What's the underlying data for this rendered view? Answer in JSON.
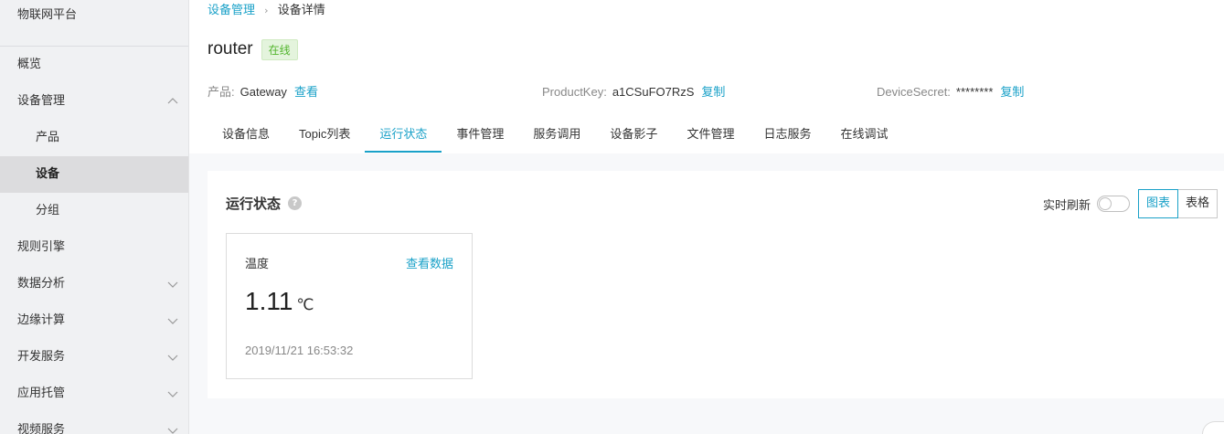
{
  "sidebar": {
    "title": "物联网平台",
    "items": [
      {
        "label": "概览",
        "type": "top",
        "chevron": "none"
      },
      {
        "label": "设备管理",
        "type": "top",
        "chevron": "up"
      },
      {
        "label": "产品",
        "type": "sub",
        "chevron": "none"
      },
      {
        "label": "设备",
        "type": "sub",
        "chevron": "none",
        "active": true
      },
      {
        "label": "分组",
        "type": "sub",
        "chevron": "none"
      },
      {
        "label": "规则引擎",
        "type": "top",
        "chevron": "none"
      },
      {
        "label": "数据分析",
        "type": "top",
        "chevron": "down"
      },
      {
        "label": "边缘计算",
        "type": "top",
        "chevron": "down"
      },
      {
        "label": "开发服务",
        "type": "top",
        "chevron": "down"
      },
      {
        "label": "应用托管",
        "type": "top",
        "chevron": "down"
      },
      {
        "label": "视频服务",
        "type": "top",
        "chevron": "down"
      }
    ]
  },
  "breadcrumb": {
    "parent": "设备管理",
    "separator": "›",
    "current": "设备详情"
  },
  "device": {
    "name": "router",
    "status": "在线"
  },
  "meta": {
    "product_key_label": "产品:",
    "product_value": "Gateway",
    "product_action": "查看",
    "productkey_label": "ProductKey:",
    "productkey_value": "a1CSuFO7RzS",
    "productkey_action": "复制",
    "devicesecret_label": "DeviceSecret:",
    "devicesecret_value": "********",
    "devicesecret_action": "复制"
  },
  "tabs": [
    {
      "label": "设备信息",
      "active": false
    },
    {
      "label": "Topic列表",
      "active": false
    },
    {
      "label": "运行状态",
      "active": true
    },
    {
      "label": "事件管理",
      "active": false
    },
    {
      "label": "服务调用",
      "active": false
    },
    {
      "label": "设备影子",
      "active": false
    },
    {
      "label": "文件管理",
      "active": false
    },
    {
      "label": "日志服务",
      "active": false
    },
    {
      "label": "在线调试",
      "active": false
    }
  ],
  "panel": {
    "title": "运行状态",
    "help_glyph": "?",
    "refresh_label": "实时刷新",
    "view_chart": "图表",
    "view_table": "表格"
  },
  "card": {
    "label": "温度",
    "link": "查看数据",
    "value": "1.11",
    "unit": "℃",
    "timestamp": "2019/11/21 16:53:32"
  },
  "colors": {
    "accent": "#1aa1c8",
    "online_text": "#52b52d",
    "online_bg": "#e4f4dd"
  }
}
